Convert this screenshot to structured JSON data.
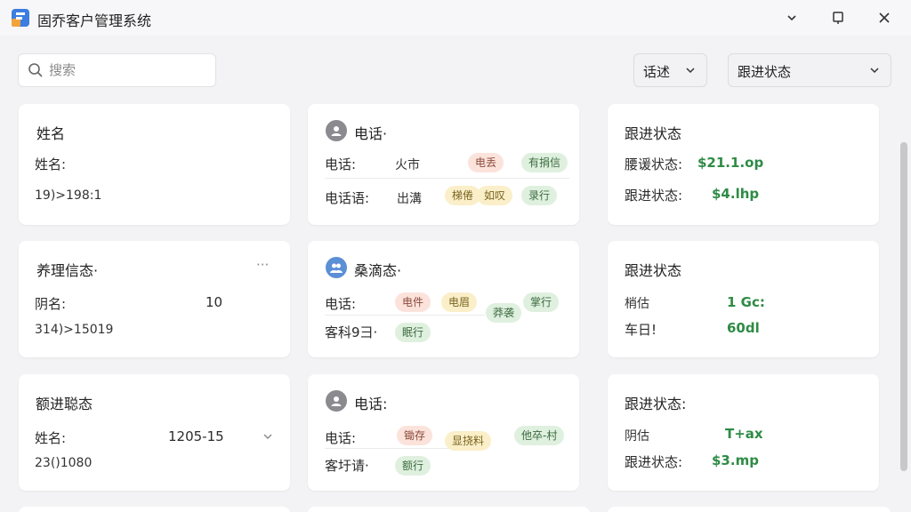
{
  "window": {
    "title": "固乔客户管理系统",
    "controls": [
      "minimize",
      "restore",
      "close"
    ]
  },
  "toolbar": {
    "search_placeholder": "搜索",
    "filter1_label": "话述",
    "filter2_label": "跟进状态"
  },
  "cards": {
    "r1c1": {
      "title": "姓名",
      "line1": "姓名:",
      "line2": "19)>198:1"
    },
    "r1c2": {
      "title": "电话·",
      "row1_label": "电话:",
      "row1_val": "火市",
      "row1_tag1": "电丢",
      "row1_tag2": "有捐信",
      "row2_label": "电话语:",
      "row2_val": "出溝",
      "row2_tag1": "梯倦",
      "row2_tag2": "如叹",
      "row2_tag3": "录行"
    },
    "r1c3": {
      "title": "跟进状态",
      "line1_label": "腰谖状态:",
      "line1_val": "$21.1.op",
      "line2_label": "跟进状态:",
      "line2_val": "$4.lhp"
    },
    "r2c1": {
      "title": "养理信态·",
      "more": "···",
      "line1_label": "阴名:",
      "line1_val": "10",
      "line2": "314)>15019"
    },
    "r2c2": {
      "title": "桑滴态·",
      "row1_label": "电话:",
      "row1_tag1": "电件",
      "row1_tag2": "电眉",
      "row1_tag3": "莽袭",
      "row1_tag4": "掌行",
      "row2_label": "客科9彐·",
      "row2_tag1": "眠行"
    },
    "r2c3": {
      "title": "跟进状态",
      "line1_label": "梢估",
      "line1_val": "1 Gc:",
      "line2_label": "车日!",
      "line2_val": "60dl"
    },
    "r3c1": {
      "title": "额进聪态",
      "line1_label": "姓名:",
      "line1_val": "1205-15",
      "line2": "23()1080"
    },
    "r3c2": {
      "title": "电话:",
      "row1_label": "电话:",
      "row1_tag1": "锄存",
      "row1_tag2": "显挠料",
      "row1_tag3": "他卒-村",
      "row2_label": "客圩请·",
      "row2_tag1": "额行"
    },
    "r3c3": {
      "title": "跟进状态:",
      "line1_label": "阴估",
      "line1_val": "T+ax",
      "line2_label": "跟进状态:",
      "line2_val": "$3.mp"
    }
  },
  "colors": {
    "accent_green": "#2e8b45",
    "tag_red_bg": "#fbe3dc",
    "tag_green_bg": "#dff0df",
    "tag_yellow_bg": "#fbefc9"
  }
}
